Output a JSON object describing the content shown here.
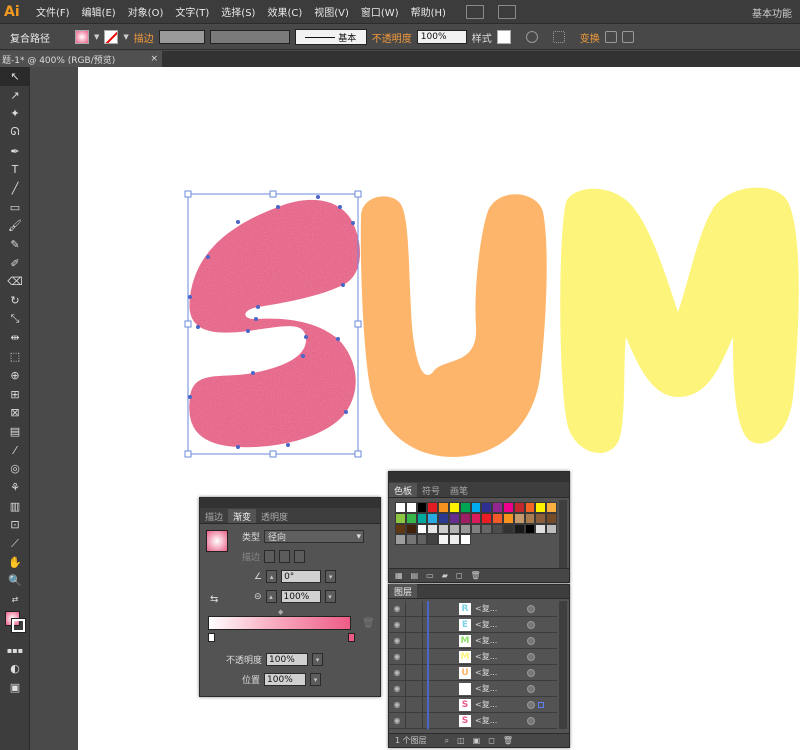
{
  "app": {
    "logo": "Ai",
    "workspace": "基本功能"
  },
  "menu": [
    "文件(F)",
    "编辑(E)",
    "对象(O)",
    "文字(T)",
    "选择(S)",
    "效果(C)",
    "视图(V)",
    "窗口(W)",
    "帮助(H)"
  ],
  "control": {
    "object_type": "复合路径",
    "stroke_label": "描边",
    "stroke_style": "基本",
    "opacity_label": "不透明度",
    "opacity_value": "100%",
    "style_label": "样式",
    "transform_label": "变换"
  },
  "doc_tab": {
    "title": "题-1* @ 400% (RGB/预览)",
    "close": "×"
  },
  "colors": {
    "s_fill": "#ec5c86",
    "u_fill": "#fdb56b",
    "m_fill": "#fdf57b",
    "accent_orange": "#f39b3c"
  },
  "gradient_panel": {
    "tabs": [
      "描边",
      "渐变",
      "透明度"
    ],
    "active_tab": "渐变",
    "type_label": "类型",
    "type_value": "径向",
    "stroke_label": "描边",
    "angle_value": "0°",
    "aspect_value": "100%",
    "opacity_label": "不透明度",
    "opacity_value": "100%",
    "location_label": "位置",
    "location_value": "100%"
  },
  "swatch_panel": {
    "tabs": [
      "色板",
      "符号",
      "画笔"
    ],
    "active_tab": "色板",
    "swatches": [
      "#ffffff",
      "#ffffff",
      "#000000",
      "#e31b23",
      "#f7931e",
      "#fff200",
      "#00a651",
      "#00aeef",
      "#2e3192",
      "#92278f",
      "#ec008c",
      "#c1272d",
      "#f26522",
      "#fff200",
      "#fbb040",
      "#8dc63f",
      "#39b54a",
      "#00a99d",
      "#27aae1",
      "#2b3990",
      "#662d91",
      "#9e1f63",
      "#da1c5c",
      "#ed1c24",
      "#f15a29",
      "#f7941d",
      "#c49a6c",
      "#a97c50",
      "#8b5e3c",
      "#754c29",
      "#603913",
      "#42210b",
      "#ffffff",
      "#e6e6e6",
      "#cccccc",
      "#b3b3b3",
      "#999999",
      "#808080",
      "#666666",
      "#4d4d4d",
      "#333333",
      "#1a1a1a",
      "#000000",
      "#e0e0e0",
      "#bdbdbd",
      "#9e9e9e",
      "#757575",
      "#616161",
      "#424242",
      "#f5f5f5",
      "#eeeeee",
      "#ffffff"
    ]
  },
  "layers_panel": {
    "title": "图层",
    "count_label": "1 个图层",
    "rows": [
      {
        "letter": "R",
        "color": "#7ed3e6",
        "name": "<复..."
      },
      {
        "letter": "E",
        "color": "#7ed3e6",
        "name": "<复..."
      },
      {
        "letter": "M",
        "color": "#8fe06e",
        "name": "<复..."
      },
      {
        "letter": "M",
        "color": "#fdf57b",
        "name": "<复..."
      },
      {
        "letter": "U",
        "color": "#fdb56b",
        "name": "<复..."
      },
      {
        "letter": "",
        "color": "#ffffff",
        "name": "<复..."
      },
      {
        "letter": "S",
        "color": "#ec5c86",
        "name": "<复..."
      },
      {
        "letter": "S",
        "color": "#ec5c86",
        "name": "<复..."
      }
    ]
  }
}
